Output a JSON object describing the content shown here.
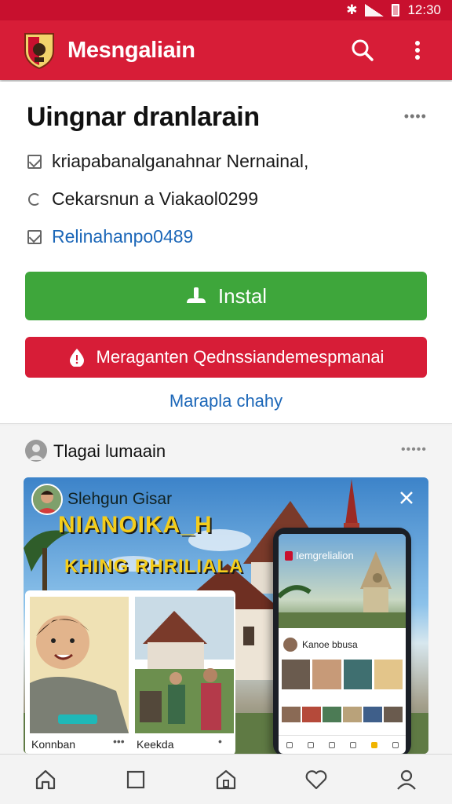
{
  "status": {
    "time": "12:30"
  },
  "appbar": {
    "title": "Mesngaliain"
  },
  "card": {
    "title": "Uingnar dranlarain",
    "rows": [
      {
        "icon": "checkbox-icon",
        "text": "kriapabanalganahnar Nernainal,"
      },
      {
        "icon": "loading-icon",
        "text": "Cekarsnun a Viakaol0299"
      },
      {
        "icon": "checkbox-icon",
        "text": "Relinahanpo0489"
      }
    ],
    "install_label": "Instal",
    "warning_label": "Meraganten Qednssiandemespmanai",
    "link_label": "Marapla chahy"
  },
  "section": {
    "title": "Tlagai lumaain",
    "banner": {
      "kicker": "Slehgun Gisar",
      "headline": "NIANOIKA_H",
      "subheadline": "KHING RHRILIALA",
      "tiles": [
        {
          "label": "Konnban"
        },
        {
          "label": "Keekda"
        }
      ],
      "phone": {
        "app_title": "Iemgrelialion",
        "profile_name": "Kanoe bbusa"
      }
    }
  },
  "colors": {
    "brand_red": "#d71d37",
    "install_green": "#3ea63b",
    "link_blue": "#1c67b8",
    "banner_yellow": "#f4cd1c"
  },
  "icons": {
    "appbar": [
      "search-icon",
      "more-vert-icon"
    ],
    "bottom_nav": [
      "home-icon",
      "square-icon",
      "house-icon",
      "heart-icon",
      "profile-icon"
    ]
  }
}
